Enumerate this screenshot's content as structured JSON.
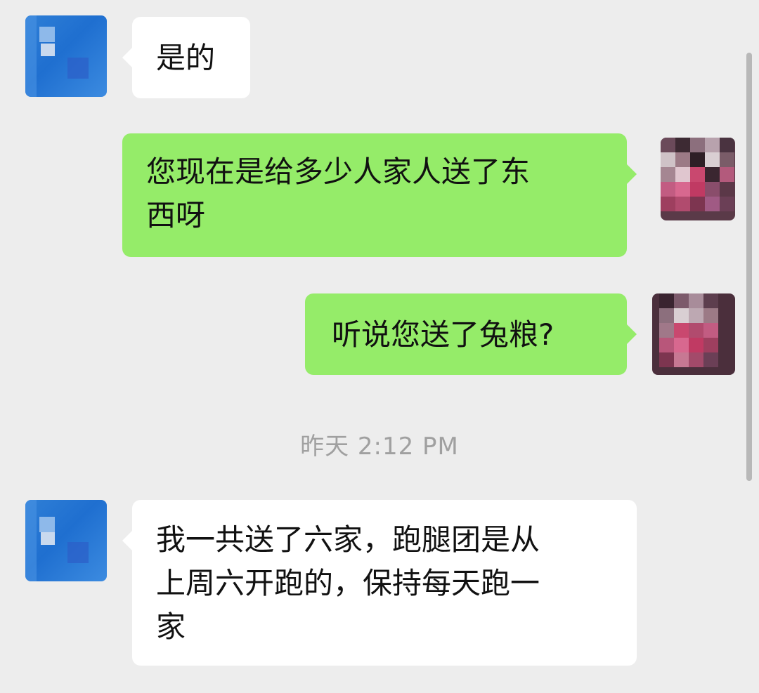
{
  "messages": [
    {
      "direction": "in",
      "text": "是的"
    },
    {
      "direction": "out",
      "text": "您现在是给多少人家人送了东\n西呀"
    },
    {
      "direction": "out",
      "text": "听说您送了兔粮?"
    },
    {
      "direction": "in",
      "text": "我一共送了六家，跑腿团是从\n上周六开跑的，保持每天跑一\n家"
    }
  ],
  "timestamp": "昨天 2:12 PM",
  "colors": {
    "background": "#ededed",
    "incoming_bubble": "#ffffff",
    "outgoing_bubble": "#95ec69",
    "timestamp_text": "#a0a0a0"
  },
  "icons": [
    "contact-avatar-icon",
    "self-avatar-icon"
  ]
}
